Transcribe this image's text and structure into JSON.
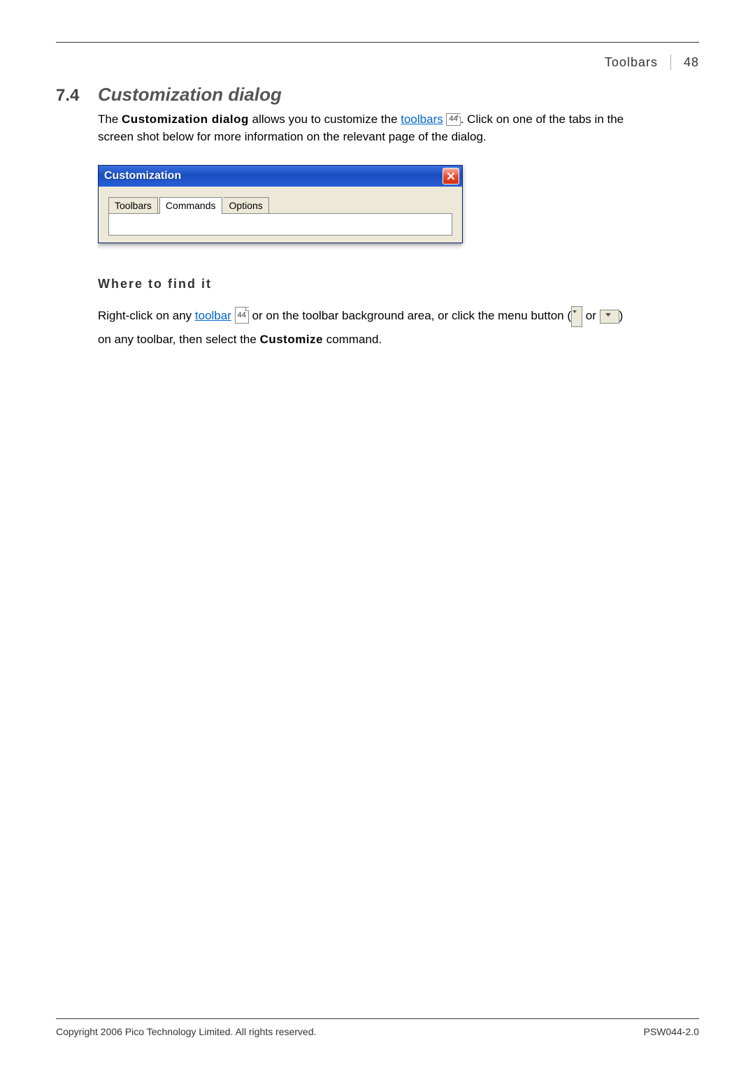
{
  "header": {
    "section_name": "Toolbars",
    "page_number": "48"
  },
  "section": {
    "number": "7.4",
    "title": "Customization dialog"
  },
  "intro": {
    "t1": "The ",
    "bold1": "Customization dialog",
    "t2": " allows you to customize the ",
    "link1": "toolbars",
    "ref1": "44",
    "t3": ". Click on one of the tabs in the screen shot below for more information on the relevant page of the dialog."
  },
  "dialog": {
    "title": "Customization",
    "tabs": {
      "t0": "Toolbars",
      "t1": "Commands",
      "t2": "Options"
    }
  },
  "where_heading": "Where to find it",
  "where_body": {
    "t1": "Right-click on any ",
    "link1": "toolbar",
    "ref1": "44",
    "t2": " or on the toolbar background area, or click the menu button (",
    "t3": " or ",
    "t4": ") on any toolbar, then select the ",
    "bold1": "Customize",
    "t5": " command."
  },
  "footer": {
    "copyright": "Copyright 2006 Pico Technology Limited. All rights reserved.",
    "docref": "PSW044-2.0"
  }
}
